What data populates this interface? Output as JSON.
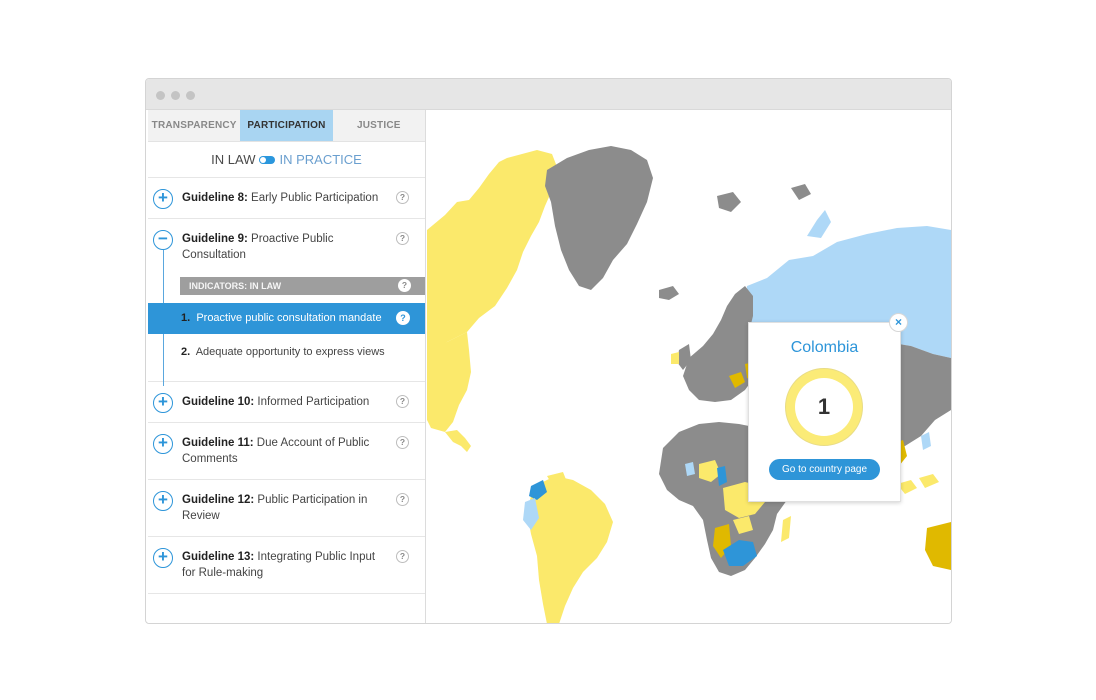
{
  "sidebar": {
    "tabs": [
      {
        "label": "TRANSPARENCY",
        "active": false
      },
      {
        "label": "PARTICIPATION",
        "active": true
      },
      {
        "label": "JUSTICE",
        "active": false
      }
    ],
    "toggle": {
      "left_label": "IN LAW",
      "right_label": "IN PRACTICE"
    },
    "guidelines": [
      {
        "number": "Guideline 8:",
        "title": "Early Public Participation",
        "expanded": false
      },
      {
        "number": "Guideline 9:",
        "title": "Proactive Public Consultation",
        "expanded": true
      },
      {
        "number": "Guideline 10:",
        "title": "Informed Participation",
        "expanded": false
      },
      {
        "number": "Guideline 11:",
        "title": "Due Account of Public Comments",
        "expanded": false
      },
      {
        "number": "Guideline 12:",
        "title": "Public Participation in Review",
        "expanded": false
      },
      {
        "number": "Guideline 13:",
        "title": "Integrating Public Input for Rule-making",
        "expanded": false
      }
    ],
    "indicators_header": "INDICATORS: IN LAW",
    "indicators": [
      {
        "num": "1.",
        "text": "Proactive public consultation mandate",
        "active": true
      },
      {
        "num": "2.",
        "text": "Adequate opportunity to express views",
        "active": false
      }
    ],
    "plus_glyph": "+",
    "minus_glyph": "−",
    "help_glyph": "?"
  },
  "popup": {
    "country": "Colombia",
    "score": "1",
    "button": "Go to country page",
    "close_glyph": "×"
  },
  "colors": {
    "accent": "#2e95d8",
    "score_yellow": "#fbe96b",
    "score_gold": "#e0b900",
    "light_blue": "#aed8f7",
    "gray": "#8c8c8c"
  }
}
